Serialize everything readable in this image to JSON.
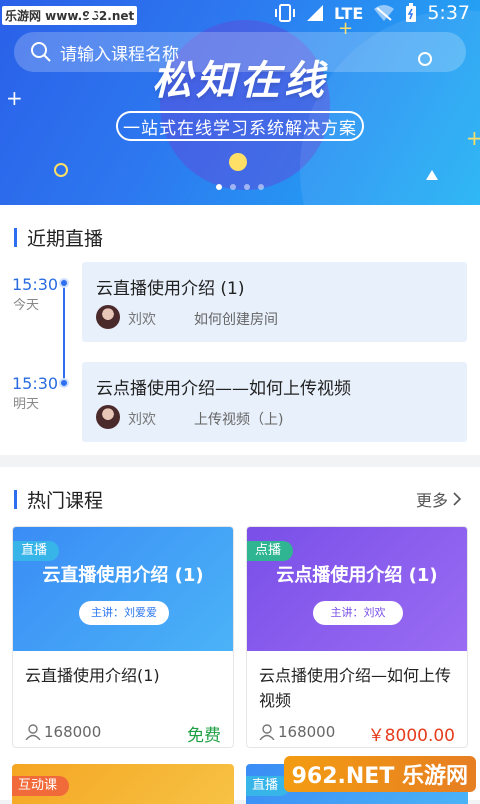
{
  "status": {
    "watermark": "乐游网 www.962.net",
    "network": "LTE",
    "time": "5:37"
  },
  "banner": {
    "search_placeholder": "请输入课程名称",
    "title": "松知在线",
    "subtitle": "一站式在线学习系统解决方案",
    "slides": 4,
    "active_slide": 0
  },
  "live": {
    "title": "近期直播",
    "items": [
      {
        "time": "15:30",
        "day": "今天",
        "course": "云直播使用介绍 (1)",
        "teacher": "刘欢",
        "session": "如何创建房间"
      },
      {
        "time": "15:30",
        "day": "明天",
        "course": "云点播使用介绍——如何上传视频",
        "teacher": "刘欢",
        "session": "上传视频（上)"
      }
    ]
  },
  "hot": {
    "title": "热门课程",
    "more": "更多",
    "courses": [
      {
        "tag": "直播",
        "cover_title": "云直播使用介绍 (1)",
        "speaker": "主讲：刘爱爱",
        "name": "云直播使用介绍(1)",
        "count": "168000",
        "price": "免费",
        "price_color": "#22a045"
      },
      {
        "tag": "点播",
        "cover_title": "云点播使用介绍 (1)",
        "speaker": "主讲：刘欢",
        "name": "云点播使用介绍—如何上传视频",
        "count": "168000",
        "price": "￥8000.00",
        "price_color": "#e53d1e"
      }
    ],
    "next_tags": [
      "互动课",
      "直播"
    ]
  },
  "bottom_watermark": "962.NET 乐游网"
}
